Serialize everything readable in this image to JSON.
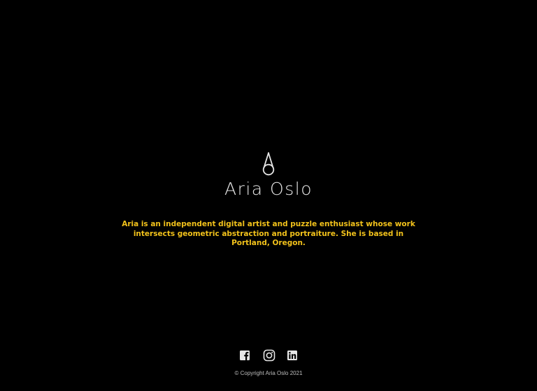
{
  "branding": {
    "logo_icon": "drop-ring-logo-icon",
    "name": "Aria Oslo"
  },
  "bio": {
    "text": "Aria is an independent digital artist and puzzle enthusiast whose work intersects geometric abstraction and portraiture. She is based in Portland, Oregon."
  },
  "social": {
    "items": [
      {
        "icon": "facebook-icon",
        "label": "Facebook"
      },
      {
        "icon": "instagram-icon",
        "label": "Instagram"
      },
      {
        "icon": "linkedin-icon",
        "label": "LinkedIn"
      }
    ]
  },
  "footer": {
    "copyright": "© Copyright Aria Oslo 2021"
  },
  "colors": {
    "background": "#000000",
    "accent": "#f2c21b",
    "text": "#e6e6e6"
  }
}
